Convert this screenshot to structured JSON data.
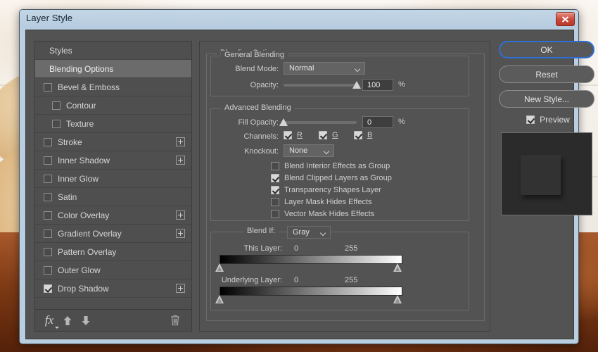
{
  "window": {
    "title": "Layer Style",
    "close_icon": "close-x-icon"
  },
  "styles_panel": {
    "items": [
      {
        "label": "Styles",
        "type": "header",
        "checkbox": null,
        "indent": false,
        "plus": false,
        "selected": false
      },
      {
        "label": "Blending Options",
        "type": "header",
        "checkbox": null,
        "indent": false,
        "plus": false,
        "selected": true
      },
      {
        "label": "Bevel & Emboss",
        "type": "effect",
        "checkbox": false,
        "indent": false,
        "plus": false,
        "selected": false
      },
      {
        "label": "Contour",
        "type": "effect",
        "checkbox": false,
        "indent": true,
        "plus": false,
        "selected": false
      },
      {
        "label": "Texture",
        "type": "effect",
        "checkbox": false,
        "indent": true,
        "plus": false,
        "selected": false
      },
      {
        "label": "Stroke",
        "type": "effect",
        "checkbox": false,
        "indent": false,
        "plus": true,
        "selected": false
      },
      {
        "label": "Inner Shadow",
        "type": "effect",
        "checkbox": false,
        "indent": false,
        "plus": true,
        "selected": false
      },
      {
        "label": "Inner Glow",
        "type": "effect",
        "checkbox": false,
        "indent": false,
        "plus": false,
        "selected": false
      },
      {
        "label": "Satin",
        "type": "effect",
        "checkbox": false,
        "indent": false,
        "plus": false,
        "selected": false
      },
      {
        "label": "Color Overlay",
        "type": "effect",
        "checkbox": false,
        "indent": false,
        "plus": true,
        "selected": false
      },
      {
        "label": "Gradient Overlay",
        "type": "effect",
        "checkbox": false,
        "indent": false,
        "plus": true,
        "selected": false
      },
      {
        "label": "Pattern Overlay",
        "type": "effect",
        "checkbox": false,
        "indent": false,
        "plus": false,
        "selected": false
      },
      {
        "label": "Outer Glow",
        "type": "effect",
        "checkbox": false,
        "indent": false,
        "plus": false,
        "selected": false
      },
      {
        "label": "Drop Shadow",
        "type": "effect",
        "checkbox": true,
        "indent": false,
        "plus": true,
        "selected": false
      }
    ],
    "toolbar": {
      "fx_label": "fx",
      "fx_icon": "fx-menu-icon",
      "move_up_icon": "arrow-up-icon",
      "move_down_icon": "arrow-down-icon",
      "delete_icon": "trash-icon"
    }
  },
  "blending_options": {
    "group_title": "Blending Options",
    "general": {
      "group_title": "General Blending",
      "blend_mode_label": "Blend Mode:",
      "blend_mode_value": "Normal",
      "opacity_label": "Opacity:",
      "opacity_value": "100",
      "opacity_unit": "%",
      "opacity_percent": 100
    },
    "advanced": {
      "group_title": "Advanced Blending",
      "fill_opacity_label": "Fill Opacity:",
      "fill_opacity_value": "0",
      "fill_opacity_unit": "%",
      "fill_opacity_percent": 0,
      "channels_label": "Channels:",
      "channels": [
        {
          "label": "R",
          "checked": true
        },
        {
          "label": "G",
          "checked": true
        },
        {
          "label": "B",
          "checked": true
        }
      ],
      "knockout_label": "Knockout:",
      "knockout_value": "None",
      "options": [
        {
          "label": "Blend Interior Effects as Group",
          "checked": false
        },
        {
          "label": "Blend Clipped Layers as Group",
          "checked": true
        },
        {
          "label": "Transparency Shapes Layer",
          "checked": true
        },
        {
          "label": "Layer Mask Hides Effects",
          "checked": false
        },
        {
          "label": "Vector Mask Hides Effects",
          "checked": false
        }
      ]
    },
    "blend_if": {
      "label": "Blend If:",
      "channel_value": "Gray",
      "this_layer": {
        "label": "This Layer:",
        "black_value": "0",
        "white_value": "255"
      },
      "underlying_layer": {
        "label": "Underlying Layer:",
        "black_value": "0",
        "white_value": "255"
      }
    }
  },
  "buttons": {
    "ok": "OK",
    "reset": "Reset",
    "new_style": "New Style...",
    "preview_label": "Preview",
    "preview_checked": true
  },
  "colors": {
    "dialog_bg": "#535353",
    "panel_bg": "#4f4f4f",
    "selected_row": "#6b6b6b",
    "titlebar": "#b9cee0",
    "close_button": "#c6483a",
    "focus_ring": "#2d6fd4",
    "text": "#cfcfcf"
  }
}
